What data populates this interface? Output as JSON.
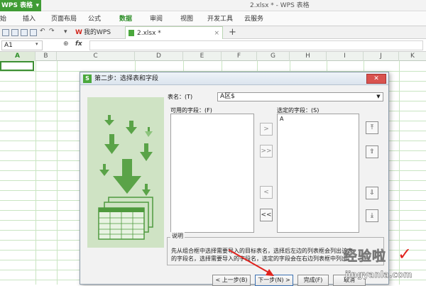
{
  "app": {
    "name": "WPS 表格",
    "doc_title": "2.xlsx * - WPS 表格"
  },
  "menu": {
    "items": [
      "始",
      "插入",
      "页面布局",
      "公式",
      "数据",
      "审阅",
      "视图",
      "开发工具",
      "云服务"
    ],
    "active": "数据"
  },
  "tabs": [
    {
      "label": "我的WPS"
    },
    {
      "label": "2.xlsx *"
    }
  ],
  "formula_bar": {
    "cell": "A1",
    "fx": "fx"
  },
  "columns": [
    "A",
    "B",
    "C",
    "D",
    "E",
    "F",
    "G",
    "H",
    "I",
    "J",
    "K"
  ],
  "dialog": {
    "title": "第二步：选择表和字段",
    "table_label": "表名：(T)",
    "table_value": "A区$",
    "available_label": "可用的字段：(F)",
    "selected_label": "选定的字段：(S)",
    "selected_fields": [
      "A"
    ],
    "move_buttons": [
      ">",
      ">>",
      "<",
      "<<"
    ],
    "order_buttons": [
      "⤒",
      "⇧",
      "⇩",
      "⤓"
    ],
    "desc_title": "说明",
    "desc_line1": "先从组合框中选择需要导入的目标表名，选择后左边的列表框会列出该表",
    "desc_line2": "的字段名，选择需要导入的字段名，选定的字段会在右边列表框中列出。",
    "buttons": {
      "prev": "< 上一步(B)",
      "next": "下一步(N) >",
      "finish": "完成(F)",
      "cancel": "取消"
    }
  },
  "watermark": {
    "line1": "经验啦",
    "line2": "jingyanla.com"
  },
  "colors": {
    "accent": "#3f9c35",
    "dialog_art": "#cfe3c4",
    "annotation": "#e0231e"
  }
}
